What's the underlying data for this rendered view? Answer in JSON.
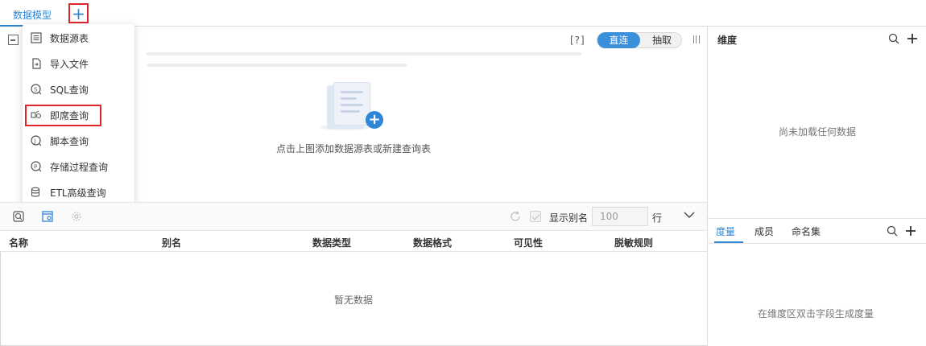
{
  "tabs": {
    "active_label": "数据模型",
    "add_label": "+"
  },
  "canvas": {
    "help_label": "[?]",
    "mode_direct": "直连",
    "mode_extract": "抽取",
    "empty_hint": "点击上图添加数据源表或新建查询表"
  },
  "menu": {
    "items": [
      {
        "label": "数据源表",
        "icon": "table-icon"
      },
      {
        "label": "导入文件",
        "icon": "import-file-icon"
      },
      {
        "label": "SQL查询",
        "icon": "sql-query-icon"
      },
      {
        "label": "即席查询",
        "icon": "adhoc-query-icon"
      },
      {
        "label": "脚本查询",
        "icon": "script-query-icon"
      },
      {
        "label": "存储过程查询",
        "icon": "stored-procedure-icon"
      },
      {
        "label": "ETL高级查询",
        "icon": "etl-query-icon"
      }
    ],
    "highlighted_item": "即席查询"
  },
  "toolbar": {
    "show_alias_label": "显示别名",
    "row_count_value": "100",
    "row_label": "行"
  },
  "table": {
    "columns": [
      "名称",
      "别名",
      "数据类型",
      "数据格式",
      "可见性",
      "脱敏规则"
    ],
    "empty_text": "暂无数据"
  },
  "right_panel": {
    "dimension_title": "维度",
    "dimension_empty": "尚未加载任何数据",
    "measure_tabs": [
      "度量",
      "成员",
      "命名集"
    ],
    "active_measure_tab": "度量",
    "measure_empty": "在维度区双击字段生成度量"
  },
  "colors": {
    "accent": "#2f86d6",
    "highlight_border": "#e0252b"
  }
}
